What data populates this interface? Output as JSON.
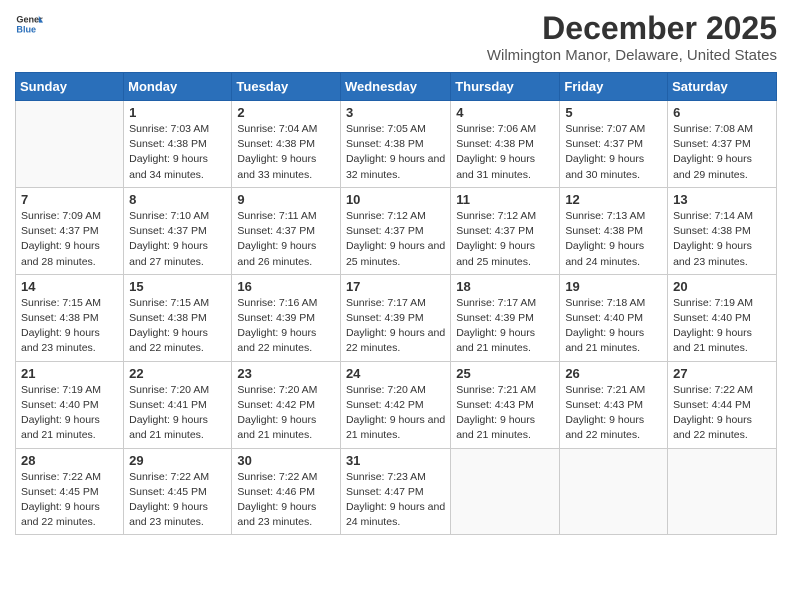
{
  "header": {
    "logo": {
      "general": "General",
      "blue": "Blue"
    },
    "title": "December 2025",
    "location": "Wilmington Manor, Delaware, United States"
  },
  "calendar": {
    "days_of_week": [
      "Sunday",
      "Monday",
      "Tuesday",
      "Wednesday",
      "Thursday",
      "Friday",
      "Saturday"
    ],
    "weeks": [
      [
        {
          "day": "",
          "sunrise": "",
          "sunset": "",
          "daylight": ""
        },
        {
          "day": "1",
          "sunrise": "7:03 AM",
          "sunset": "4:38 PM",
          "daylight": "9 hours and 34 minutes."
        },
        {
          "day": "2",
          "sunrise": "7:04 AM",
          "sunset": "4:38 PM",
          "daylight": "9 hours and 33 minutes."
        },
        {
          "day": "3",
          "sunrise": "7:05 AM",
          "sunset": "4:38 PM",
          "daylight": "9 hours and 32 minutes."
        },
        {
          "day": "4",
          "sunrise": "7:06 AM",
          "sunset": "4:38 PM",
          "daylight": "9 hours and 31 minutes."
        },
        {
          "day": "5",
          "sunrise": "7:07 AM",
          "sunset": "4:37 PM",
          "daylight": "9 hours and 30 minutes."
        },
        {
          "day": "6",
          "sunrise": "7:08 AM",
          "sunset": "4:37 PM",
          "daylight": "9 hours and 29 minutes."
        }
      ],
      [
        {
          "day": "7",
          "sunrise": "7:09 AM",
          "sunset": "4:37 PM",
          "daylight": "9 hours and 28 minutes."
        },
        {
          "day": "8",
          "sunrise": "7:10 AM",
          "sunset": "4:37 PM",
          "daylight": "9 hours and 27 minutes."
        },
        {
          "day": "9",
          "sunrise": "7:11 AM",
          "sunset": "4:37 PM",
          "daylight": "9 hours and 26 minutes."
        },
        {
          "day": "10",
          "sunrise": "7:12 AM",
          "sunset": "4:37 PM",
          "daylight": "9 hours and 25 minutes."
        },
        {
          "day": "11",
          "sunrise": "7:12 AM",
          "sunset": "4:37 PM",
          "daylight": "9 hours and 25 minutes."
        },
        {
          "day": "12",
          "sunrise": "7:13 AM",
          "sunset": "4:38 PM",
          "daylight": "9 hours and 24 minutes."
        },
        {
          "day": "13",
          "sunrise": "7:14 AM",
          "sunset": "4:38 PM",
          "daylight": "9 hours and 23 minutes."
        }
      ],
      [
        {
          "day": "14",
          "sunrise": "7:15 AM",
          "sunset": "4:38 PM",
          "daylight": "9 hours and 23 minutes."
        },
        {
          "day": "15",
          "sunrise": "7:15 AM",
          "sunset": "4:38 PM",
          "daylight": "9 hours and 22 minutes."
        },
        {
          "day": "16",
          "sunrise": "7:16 AM",
          "sunset": "4:39 PM",
          "daylight": "9 hours and 22 minutes."
        },
        {
          "day": "17",
          "sunrise": "7:17 AM",
          "sunset": "4:39 PM",
          "daylight": "9 hours and 22 minutes."
        },
        {
          "day": "18",
          "sunrise": "7:17 AM",
          "sunset": "4:39 PM",
          "daylight": "9 hours and 21 minutes."
        },
        {
          "day": "19",
          "sunrise": "7:18 AM",
          "sunset": "4:40 PM",
          "daylight": "9 hours and 21 minutes."
        },
        {
          "day": "20",
          "sunrise": "7:19 AM",
          "sunset": "4:40 PM",
          "daylight": "9 hours and 21 minutes."
        }
      ],
      [
        {
          "day": "21",
          "sunrise": "7:19 AM",
          "sunset": "4:40 PM",
          "daylight": "9 hours and 21 minutes."
        },
        {
          "day": "22",
          "sunrise": "7:20 AM",
          "sunset": "4:41 PM",
          "daylight": "9 hours and 21 minutes."
        },
        {
          "day": "23",
          "sunrise": "7:20 AM",
          "sunset": "4:42 PM",
          "daylight": "9 hours and 21 minutes."
        },
        {
          "day": "24",
          "sunrise": "7:20 AM",
          "sunset": "4:42 PM",
          "daylight": "9 hours and 21 minutes."
        },
        {
          "day": "25",
          "sunrise": "7:21 AM",
          "sunset": "4:43 PM",
          "daylight": "9 hours and 21 minutes."
        },
        {
          "day": "26",
          "sunrise": "7:21 AM",
          "sunset": "4:43 PM",
          "daylight": "9 hours and 22 minutes."
        },
        {
          "day": "27",
          "sunrise": "7:22 AM",
          "sunset": "4:44 PM",
          "daylight": "9 hours and 22 minutes."
        }
      ],
      [
        {
          "day": "28",
          "sunrise": "7:22 AM",
          "sunset": "4:45 PM",
          "daylight": "9 hours and 22 minutes."
        },
        {
          "day": "29",
          "sunrise": "7:22 AM",
          "sunset": "4:45 PM",
          "daylight": "9 hours and 23 minutes."
        },
        {
          "day": "30",
          "sunrise": "7:22 AM",
          "sunset": "4:46 PM",
          "daylight": "9 hours and 23 minutes."
        },
        {
          "day": "31",
          "sunrise": "7:23 AM",
          "sunset": "4:47 PM",
          "daylight": "9 hours and 24 minutes."
        },
        {
          "day": "",
          "sunrise": "",
          "sunset": "",
          "daylight": ""
        },
        {
          "day": "",
          "sunrise": "",
          "sunset": "",
          "daylight": ""
        },
        {
          "day": "",
          "sunrise": "",
          "sunset": "",
          "daylight": ""
        }
      ]
    ]
  }
}
